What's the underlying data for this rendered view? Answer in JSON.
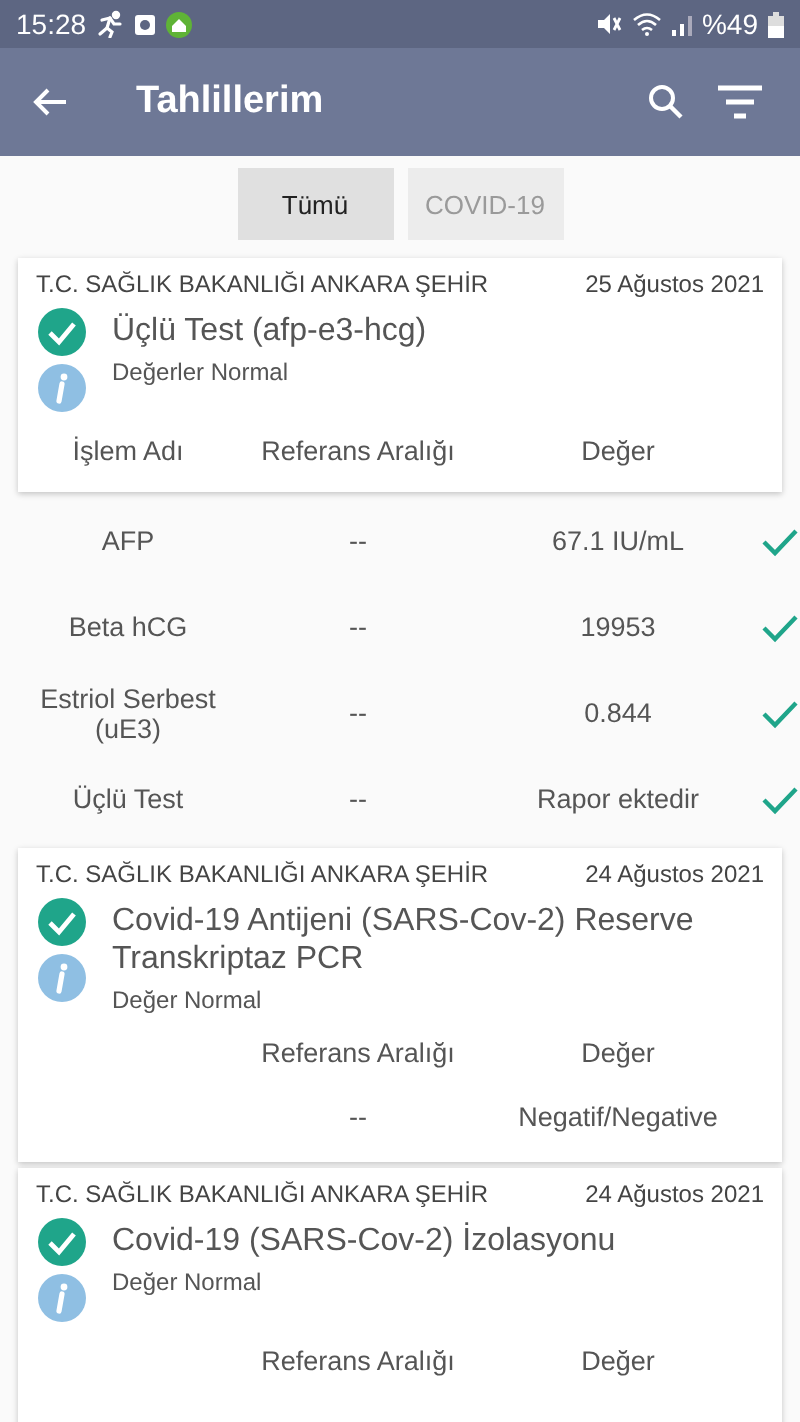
{
  "status_bar": {
    "time": "15:28",
    "battery": "%49"
  },
  "app_bar": {
    "title": "Tahlillerim"
  },
  "filters": [
    {
      "label": "Tümü",
      "selected": true
    },
    {
      "label": "COVID-19",
      "selected": false
    }
  ],
  "results": [
    {
      "institution": "T.C. SAĞLIK BAKANLIĞI ANKARA ŞEHİR",
      "date": "25 Ağustos 2021",
      "title": "Üçlü Test (afp-e3-hcg)",
      "summary": "Değerler Normal",
      "expanded": true,
      "header": {
        "name": "İşlem Adı",
        "reference": "Referans Aralığı",
        "value": "Değer"
      },
      "rows": [
        {
          "name": "AFP",
          "reference": "--",
          "value": "67.1 IU/mL",
          "checked": true
        },
        {
          "name": "Beta hCG",
          "reference": "--",
          "value": "19953",
          "checked": true
        },
        {
          "name": "Estriol Serbest (uE3)",
          "reference": "--",
          "value": "0.844",
          "checked": true
        },
        {
          "name": "Üçlü Test",
          "reference": "--",
          "value": "Rapor ektedir",
          "checked": true
        }
      ]
    },
    {
      "institution": "T.C. SAĞLIK BAKANLIĞI ANKARA ŞEHİR",
      "date": "24 Ağustos 2021",
      "title": "Covid-19 Antijeni (SARS-Cov-2) Reserve Transkriptaz PCR",
      "summary": "Değer Normal",
      "expanded": false,
      "header": {
        "reference": "Referans Aralığı",
        "value": "Değer"
      },
      "rows": [
        {
          "reference": "--",
          "value": "Negatif/Negative",
          "checked": false
        }
      ]
    },
    {
      "institution": "T.C. SAĞLIK BAKANLIĞI ANKARA ŞEHİR",
      "date": "24 Ağustos 2021",
      "title": "Covid-19 (SARS-Cov-2) İzolasyonu",
      "summary": "Değer Normal",
      "expanded": false,
      "header": {
        "reference": "Referans Aralığı",
        "value": "Değer"
      }
    }
  ]
}
